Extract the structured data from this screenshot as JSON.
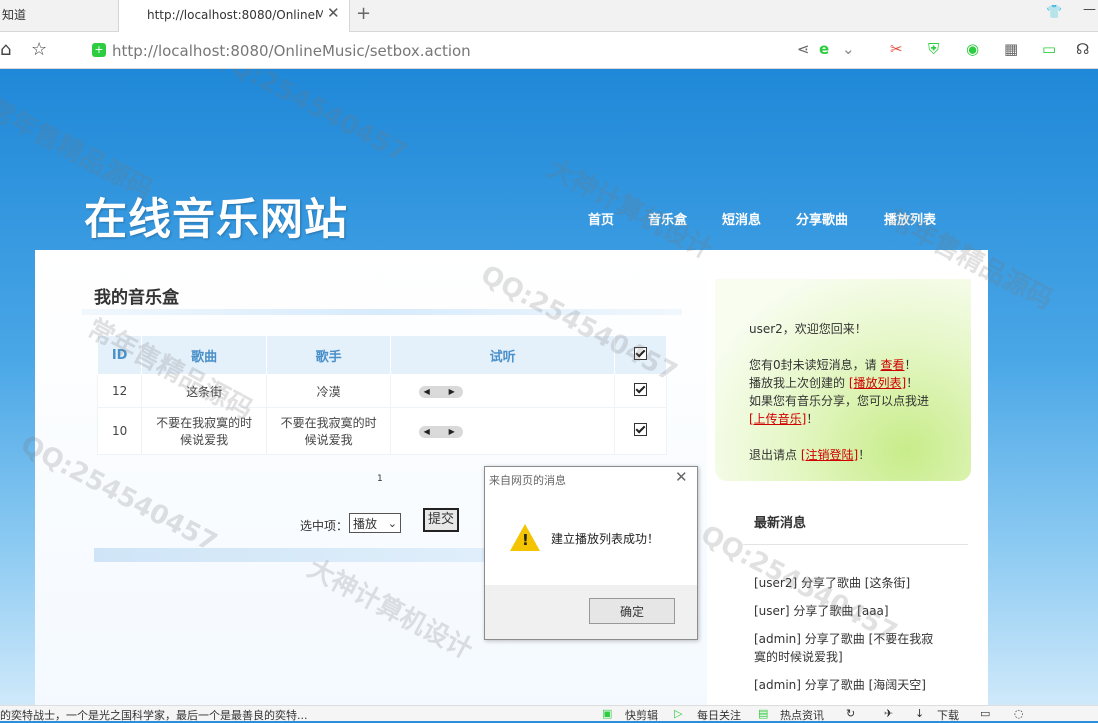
{
  "browser": {
    "prev_tab_label": "知道",
    "active_tab_title": "http://localhost:8080/OnlineM",
    "url_host": "http://localhost",
    "url_rest": ":8080/OnlineMusic/setbox.action"
  },
  "site": {
    "title": "在线音乐网站",
    "nav": [
      "首页",
      "音乐盒",
      "短消息",
      "分享歌曲",
      "播放列表"
    ]
  },
  "main": {
    "heading": "我的音乐盒",
    "table": {
      "headers": [
        "ID",
        "歌曲",
        "歌手",
        "试听"
      ],
      "rows": [
        {
          "id": "12",
          "song": "这条街",
          "singer": "冷漠"
        },
        {
          "id": "10",
          "song": "不要在我寂寞的时候说爱我",
          "singer": "不要在我寂寞的时候说爱我"
        }
      ]
    },
    "pager": "1",
    "form": {
      "label": "选中项：",
      "selected_option": "播放",
      "submit_label": "提交"
    }
  },
  "sidebar": {
    "welcome": {
      "greeting": "user2，欢迎您回来！",
      "msg_prefix": "您有0封未读短消息，请",
      "msg_link": "查看",
      "msg_suffix": "！",
      "playlist_prefix": "播放我上次创建的",
      "playlist_link": "[播放列表]",
      "playlist_suffix": "！",
      "share_prefix": "如果您有音乐分享，您可以点我进",
      "share_link": "[上传音乐]",
      "share_suffix": "！",
      "logout_prefix": "退出请点",
      "logout_link": "[注销登陆]",
      "logout_suffix": "！"
    },
    "news_heading": "最新消息",
    "news": [
      "[user2] 分享了歌曲 [这条街]",
      "[user] 分享了歌曲 [aaa]",
      "[admin]  分享了歌曲  [不要在我寂寞的时候说爱我]",
      "[admin] 分享了歌曲 [海阔天空]"
    ]
  },
  "dialog": {
    "title": "来自网页的消息",
    "message": "建立播放列表成功！",
    "ok_label": "确定"
  },
  "statusbar": {
    "left_text": "的奕特战士，一个是光之国科学家，最后一个是最善良的奕特...",
    "items": [
      "快剪辑",
      "每日关注",
      "热点资讯",
      "下载"
    ]
  },
  "watermark": [
    "常年售精品源码",
    "QQ:254540457",
    "大神计算机设计"
  ],
  "colors": {
    "page_blue": "#2a8fd8",
    "table_header_text": "#4a90c9",
    "link_red": "#d10000",
    "warning_yellow": "#f5c400"
  }
}
